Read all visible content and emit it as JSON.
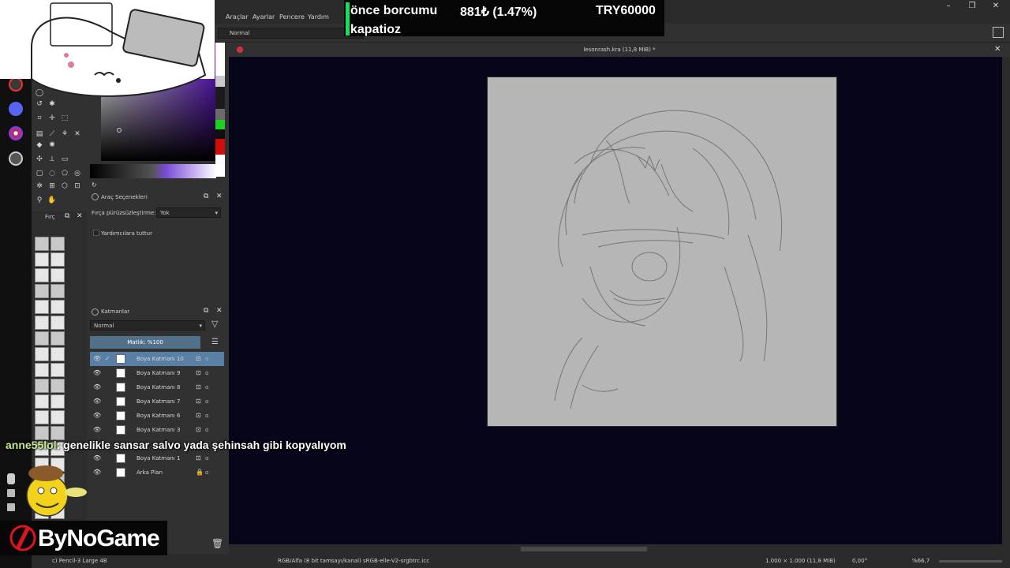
{
  "menu": {
    "items": [
      "Araçlar",
      "Ayarlar",
      "Pencere",
      "Yardım"
    ]
  },
  "toolbar": {
    "blend_mode": "Normal"
  },
  "document": {
    "title": "lesonrash.kra (11,8 MiB) *"
  },
  "tool_options": {
    "title": "Araç Seçenekleri",
    "smoothing_label": "Fırça pürüzsüzleştirme:",
    "smoothing_value": "Yok",
    "assistant_label": "Yardımcılara tuttur"
  },
  "brush_panel": {
    "title": "Fırç"
  },
  "layers": {
    "title": "Katmanlar",
    "blend_mode": "Normal",
    "opacity_label": "Matlık: %100",
    "items": [
      {
        "name": "Boya Katmanı 10",
        "active": true,
        "locked": false
      },
      {
        "name": "Boya Katmanı 9",
        "active": false,
        "locked": false
      },
      {
        "name": "Boya Katmanı 8",
        "active": false,
        "locked": false
      },
      {
        "name": "Boya Katmanı 7",
        "active": false,
        "locked": false
      },
      {
        "name": "Boya Katmanı 6",
        "active": false,
        "locked": false
      },
      {
        "name": "Boya Katmanı 3",
        "active": false,
        "locked": false
      },
      {
        "name": "Boya Katmanı 1",
        "active": false,
        "locked": false
      },
      {
        "name": "Arka Plan",
        "active": false,
        "locked": true
      }
    ]
  },
  "status": {
    "brush": "c) Pencil-3 Large 4B",
    "color_profile": "RGB/Alfa (8 bit tamsayı/kanal) sRGB-elle-V2-srgbtrc.icc",
    "canvas_size": "1.000 × 1.000 (11,8 MiB)",
    "rotation": "0,00°",
    "zoom": "%66,7"
  },
  "donation": {
    "line1": "önce borcumu",
    "amount": "881₺ (1.47%)",
    "goal": "TRY60000",
    "line2": "kapatioz"
  },
  "chat": {
    "user": "anne55lol",
    "message": ": genelikle sansar salvo yada şehinsah gibi kopyalıyom"
  },
  "logo": {
    "text": "ByNoGame"
  },
  "colors": {
    "canvas_bg": "#060519",
    "paper": "#b6b6b6",
    "active_layer": "#5a7fa5",
    "donation_bar": "#14e05a"
  }
}
